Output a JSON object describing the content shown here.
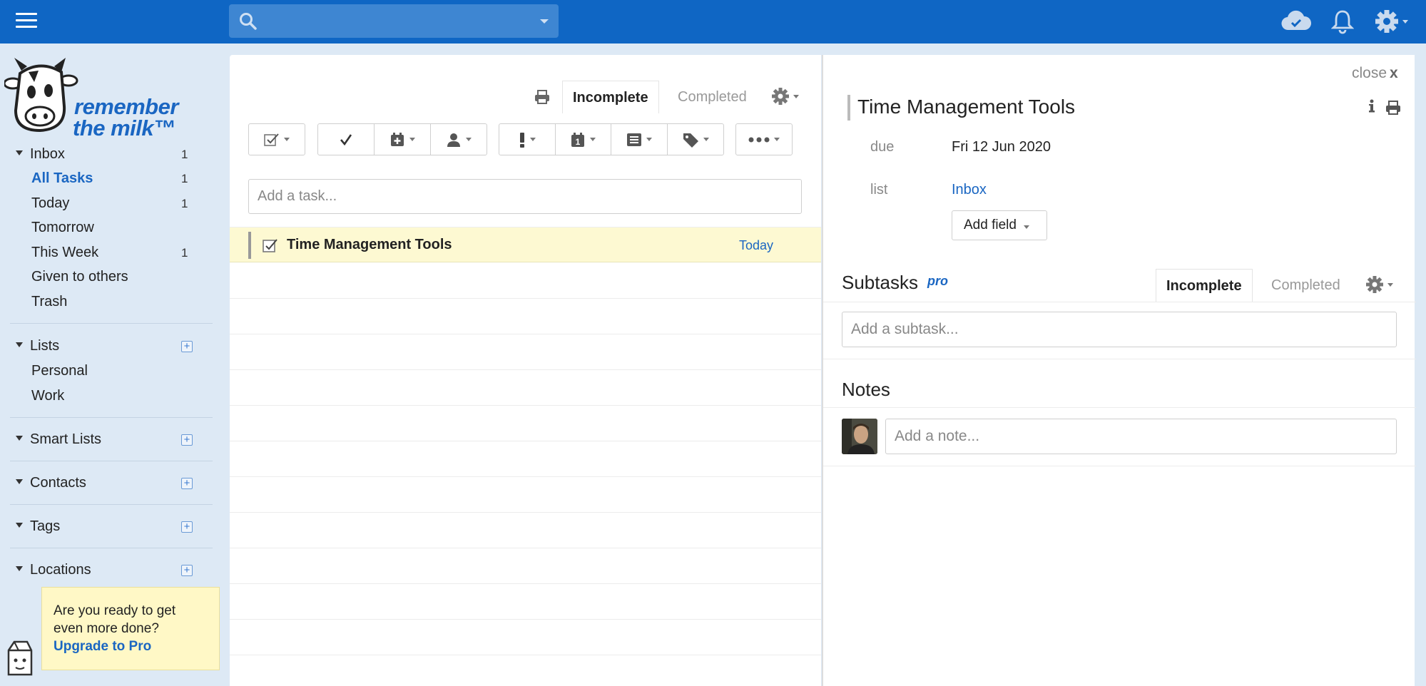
{
  "topbar": {
    "search_placeholder": "",
    "icons": [
      "menu-icon",
      "search-icon",
      "cloud-sync-icon",
      "bell-icon",
      "gear-icon"
    ]
  },
  "sidebar": {
    "logo_line1": "remember",
    "logo_line2": "the milk™",
    "inbox": {
      "label": "Inbox",
      "count": "1"
    },
    "smart_items": [
      {
        "label": "All Tasks",
        "count": "1"
      },
      {
        "label": "Today",
        "count": "1"
      },
      {
        "label": "Tomorrow",
        "count": ""
      },
      {
        "label": "This Week",
        "count": "1"
      },
      {
        "label": "Given to others",
        "count": ""
      },
      {
        "label": "Trash",
        "count": ""
      }
    ],
    "lists_label": "Lists",
    "lists": [
      "Personal",
      "Work"
    ],
    "smart_lists_label": "Smart Lists",
    "contacts_label": "Contacts",
    "tags_label": "Tags",
    "locations_label": "Locations",
    "promo": {
      "text": "Are you ready to get even more done?",
      "link": "Upgrade to Pro"
    }
  },
  "tasklist": {
    "tab_incomplete": "Incomplete",
    "tab_completed": "Completed",
    "add_task_placeholder": "Add a task...",
    "tasks": [
      {
        "name": "Time Management Tools",
        "due": "Today"
      }
    ]
  },
  "detail": {
    "close_label": "close",
    "close_x": "x",
    "title": "Time Management Tools",
    "due_label": "due",
    "due_value": "Fri 12 Jun 2020",
    "list_label": "list",
    "list_value": "Inbox",
    "add_field_label": "Add field",
    "subtasks_title": "Subtasks",
    "pro_badge": "pro",
    "sub_tab_incomplete": "Incomplete",
    "sub_tab_completed": "Completed",
    "add_subtask_placeholder": "Add a subtask...",
    "notes_title": "Notes",
    "add_note_placeholder": "Add a note..."
  },
  "colors": {
    "topbar": "#0f66c4",
    "accent_link": "#1a66c2",
    "sidebar_bg": "#dde9f5",
    "selected_row": "#fdf9d2",
    "promo_bg": "#fff8c6"
  }
}
